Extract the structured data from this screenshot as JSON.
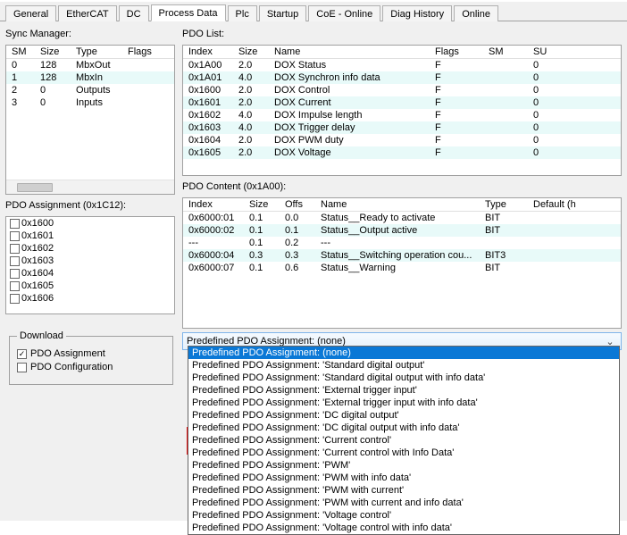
{
  "tabs": [
    "General",
    "EtherCAT",
    "DC",
    "Process Data",
    "Plc",
    "Startup",
    "CoE - Online",
    "Diag History",
    "Online"
  ],
  "active_tab": 3,
  "sync_manager": {
    "label": "Sync Manager:",
    "headers": [
      "SM",
      "Size",
      "Type",
      "Flags"
    ],
    "rows": [
      {
        "sm": "0",
        "size": "128",
        "type": "MbxOut",
        "flags": ""
      },
      {
        "sm": "1",
        "size": "128",
        "type": "MbxIn",
        "flags": ""
      },
      {
        "sm": "2",
        "size": "0",
        "type": "Outputs",
        "flags": ""
      },
      {
        "sm": "3",
        "size": "0",
        "type": "Inputs",
        "flags": ""
      }
    ],
    "selected": 1
  },
  "pdo_assignment": {
    "label": "PDO Assignment (0x1C12):",
    "items": [
      "0x1600",
      "0x1601",
      "0x1602",
      "0x1603",
      "0x1604",
      "0x1605",
      "0x1606"
    ]
  },
  "download": {
    "label": "Download",
    "items": [
      {
        "label": "PDO Assignment",
        "checked": true
      },
      {
        "label": "PDO Configuration",
        "checked": false
      }
    ]
  },
  "pdo_list": {
    "label": "PDO List:",
    "headers": [
      "Index",
      "Size",
      "Name",
      "Flags",
      "SM",
      "SU"
    ],
    "rows": [
      {
        "index": "0x1A00",
        "size": "2.0",
        "name": "DOX Status",
        "flags": "F",
        "sm": "",
        "su": "0"
      },
      {
        "index": "0x1A01",
        "size": "4.0",
        "name": "DOX Synchron info data",
        "flags": "F",
        "sm": "",
        "su": "0"
      },
      {
        "index": "0x1600",
        "size": "2.0",
        "name": "DOX Control",
        "flags": "F",
        "sm": "",
        "su": "0"
      },
      {
        "index": "0x1601",
        "size": "2.0",
        "name": "DOX Current",
        "flags": "F",
        "sm": "",
        "su": "0"
      },
      {
        "index": "0x1602",
        "size": "4.0",
        "name": "DOX Impulse length",
        "flags": "F",
        "sm": "",
        "su": "0"
      },
      {
        "index": "0x1603",
        "size": "4.0",
        "name": "DOX Trigger delay",
        "flags": "F",
        "sm": "",
        "su": "0"
      },
      {
        "index": "0x1604",
        "size": "2.0",
        "name": "DOX PWM duty",
        "flags": "F",
        "sm": "",
        "su": "0"
      },
      {
        "index": "0x1605",
        "size": "2.0",
        "name": "DOX Voltage",
        "flags": "F",
        "sm": "",
        "su": "0"
      }
    ]
  },
  "pdo_content": {
    "label": "PDO Content (0x1A00):",
    "headers": [
      "Index",
      "Size",
      "Offs",
      "Name",
      "Type",
      "Default (h"
    ],
    "rows": [
      {
        "index": "0x6000:01",
        "size": "0.1",
        "offs": "0.0",
        "name": "Status__Ready to activate",
        "type": "BIT",
        "def": ""
      },
      {
        "index": "0x6000:02",
        "size": "0.1",
        "offs": "0.1",
        "name": "Status__Output active",
        "type": "BIT",
        "def": ""
      },
      {
        "index": "---",
        "size": "0.1",
        "offs": "0.2",
        "name": "---",
        "type": "",
        "def": ""
      },
      {
        "index": "0x6000:04",
        "size": "0.3",
        "offs": "0.3",
        "name": "Status__Switching operation cou...",
        "type": "BIT3",
        "def": ""
      },
      {
        "index": "0x6000:07",
        "size": "0.1",
        "offs": "0.6",
        "name": "Status__Warning",
        "type": "BIT",
        "def": ""
      }
    ]
  },
  "combo": {
    "label": "Predefined PDO Assignment: (none)"
  },
  "dropdown": {
    "selected_index": 0,
    "items": [
      "Predefined PDO Assignment: (none)",
      "Predefined PDO Assignment: 'Standard digital output'",
      "Predefined PDO Assignment: 'Standard digital output with info data'",
      "Predefined PDO Assignment: 'External trigger input'",
      "Predefined PDO Assignment: 'External trigger input with info data'",
      "Predefined PDO Assignment: 'DC digital output'",
      "Predefined PDO Assignment: 'DC digital output with info data'",
      "Predefined PDO Assignment: 'Current control'",
      "Predefined PDO Assignment: 'Current control with Info Data'",
      "Predefined PDO Assignment: 'PWM'",
      "Predefined PDO Assignment: 'PWM with info data'",
      "Predefined PDO Assignment: 'PWM with current'",
      "Predefined PDO Assignment: 'PWM with current and info data'",
      "Predefined PDO Assignment: 'Voltage control'",
      "Predefined PDO Assignment: 'Voltage control with info data'"
    ]
  }
}
